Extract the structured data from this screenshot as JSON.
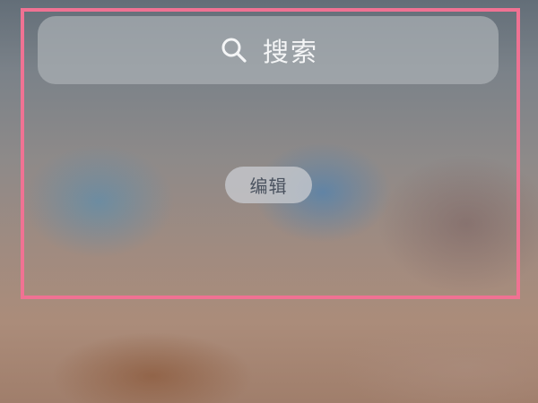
{
  "search": {
    "label": "搜索",
    "icon": "search-icon"
  },
  "edit_button": {
    "label": "编辑"
  },
  "colors": {
    "highlight_frame": "#f07293",
    "search_text": "#f4f5f6",
    "edit_text": "#4b5360"
  }
}
